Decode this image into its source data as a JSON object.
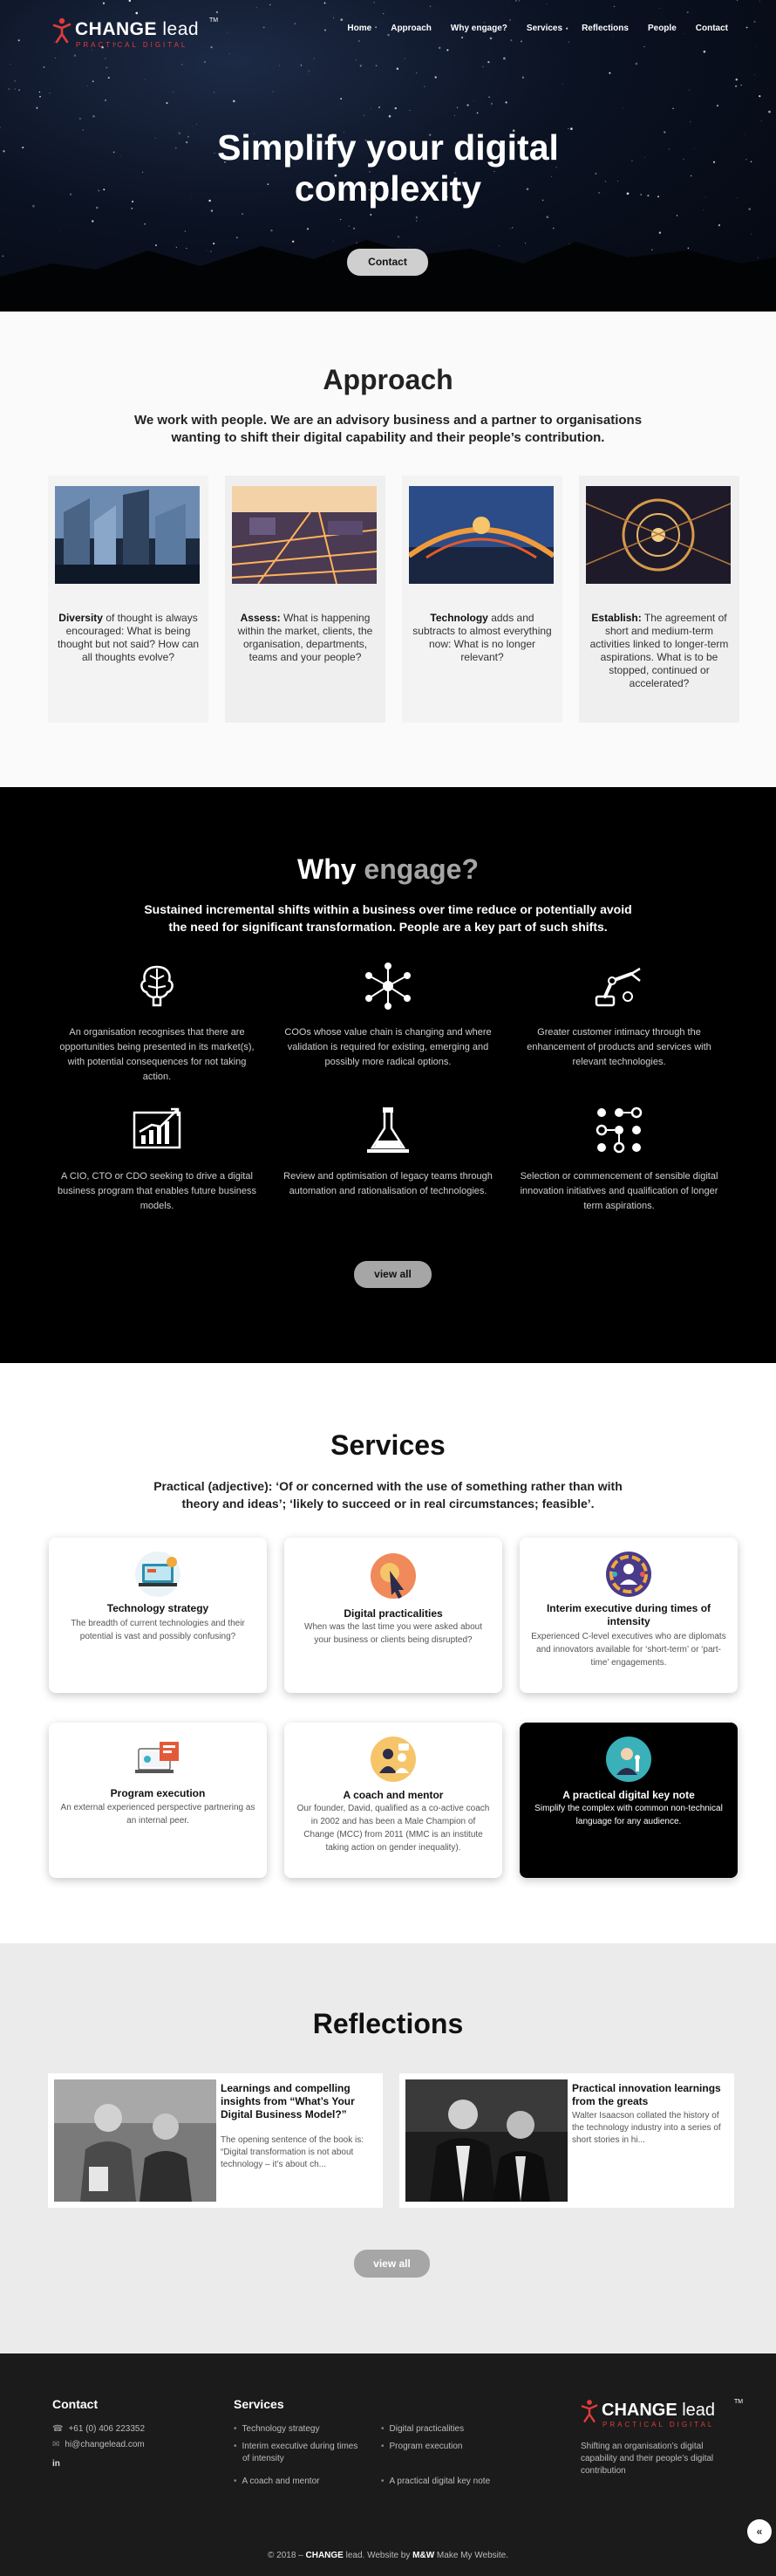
{
  "brand": {
    "name_bold": "CHANGE",
    "name_light": " lead",
    "tm": "TM",
    "tagline": "PRACTICAL DIGITAL"
  },
  "nav": [
    "Home",
    "Approach",
    "Why engage?",
    "Services",
    "Reflections",
    "People",
    "Contact"
  ],
  "hero": {
    "title_line1": "Simplify your digital",
    "title_line2": "complexity",
    "button": "Contact"
  },
  "approach": {
    "title": "Approach",
    "intro_line1": "We work with people. We are an advisory business and a partner to organisations",
    "intro_line2": "wanting to shift their digital capability and their people’s contribution.",
    "cards": [
      {
        "bold": "Diversity",
        "text": " of thought is always encouraged: What is being thought but not said? How can all thoughts evolve?"
      },
      {
        "bold": "Assess:",
        "text": " What is happening within the market, clients, the organisation, departments, teams and your people?"
      },
      {
        "bold": "Technology",
        "text": " adds and subtracts to almost everything now: What is no longer relevant?"
      },
      {
        "bold": "Establish:",
        "text": " The agreement of short and medium-term activities linked to longer-term aspirations. What is to be stopped, continued or accelerated?"
      }
    ]
  },
  "why": {
    "title_white": "Why",
    "title_grey": " engage?",
    "intro_line1": "Sustained incremental shifts within a business over time reduce or potentially avoid",
    "intro_line2": "the need for significant transformation. People are a key part of such shifts.",
    "items": [
      {
        "icon": "brain-icon",
        "text": "An organisation recognises that there are opportunities being presented in its market(s), with potential consequences for not taking action."
      },
      {
        "icon": "network-icon",
        "text": "COOs whose value chain is changing and where validation is required for existing, emerging and possibly more radical options."
      },
      {
        "icon": "robot-arm-icon",
        "text": "Greater customer intimacy through the enhancement of products and services with relevant technologies."
      },
      {
        "icon": "growth-chart-icon",
        "text": "A CIO, CTO or CDO seeking to drive a digital business program that enables future business models."
      },
      {
        "icon": "lab-flask-icon",
        "text": "Review and optimisation of legacy teams through automation and rationalisation of technologies."
      },
      {
        "icon": "nodes-grid-icon",
        "text": "Selection or commencement of sensible digital innovation initiatives and qualification of longer term aspirations."
      }
    ],
    "button": "view all"
  },
  "services": {
    "title": "Services",
    "intro_line1": "Practical (adjective): ‘Of or concerned with the use of something rather than with",
    "intro_line2": "theory and ideas’; ‘likely to succeed or in real circumstances; feasible’.",
    "cards": [
      {
        "icon": "tech-strategy-icon",
        "title": "Technology strategy",
        "text": "The breadth of current technologies and their potential is vast and possibly confusing?"
      },
      {
        "icon": "cursor-click-icon",
        "title": "Digital practicalities",
        "text": "When was the last time you were asked about your business or clients being disrupted?"
      },
      {
        "icon": "people-circle-icon",
        "title": "Interim executive during times of intensity",
        "text": "Experienced C-level executives who are diplomats and innovators available for ‘short-term’ or ‘part-time’ engagements."
      },
      {
        "icon": "laptop-execution-icon",
        "title": "Program execution",
        "text": "An external experienced perspective partnering as an internal peer."
      },
      {
        "icon": "mentor-icon",
        "title": "A coach and mentor",
        "text": "Our founder, David, qualified as a co-active coach in 2002 and has been a Male Champion of Change (MCC) from 2011 (MMC is an institute taking action on gender inequality)."
      },
      {
        "icon": "keynote-speaker-icon",
        "title": "A practical digital key note",
        "text": "Simplify the complex with common non-technical language for any audience."
      }
    ]
  },
  "reflections": {
    "title": "Reflections",
    "posts": [
      {
        "title": "Learnings and compelling insights from “What’s Your Digital Business Model?”",
        "text": "The opening sentence of the book is: “Digital transformation is not about technology – it’s about ch..."
      },
      {
        "title": "Practical innovation learnings from the greats",
        "text": "Walter Isaacson collated the history of the technology industry into a series of short stories in hi..."
      }
    ],
    "button": "view all"
  },
  "footer": {
    "contact_title": "Contact",
    "phone": "+61 (0) 406 223352",
    "email": "hi@changelead.com",
    "linkedin": "in",
    "services_title": "Services",
    "services_col1": [
      "Technology strategy",
      "Interim executive during times",
      "of intensity",
      "A coach and mentor"
    ],
    "services_col2": [
      "Digital practicalities",
      "Program execution",
      "A practical digital key note"
    ],
    "about_line1": "Shifting an organisation’s digital",
    "about_line2": "capability and their people’s digital",
    "about_line3": "contribution",
    "copyright_pre": "© 2018 – ",
    "copyright_brand": "CHANGE",
    "copyright_mid": " lead. Website by ",
    "copyright_mmw": "M&W",
    "copyright_post": " Make My Website.",
    "to_top": "«"
  }
}
